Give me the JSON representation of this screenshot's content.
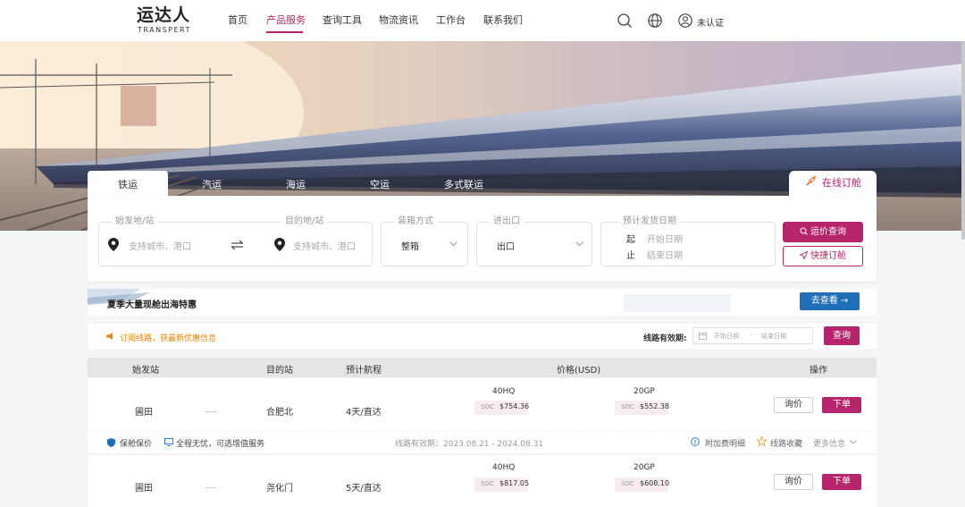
{
  "brand": {
    "logo_main": "运达人",
    "logo_sub": "TRANSPERT",
    "accent": "#b6246b"
  },
  "nav": {
    "items": [
      {
        "label": "首页"
      },
      {
        "label": "产品服务",
        "active": true
      },
      {
        "label": "查询工具"
      },
      {
        "label": "物流资讯"
      },
      {
        "label": "工作台"
      },
      {
        "label": "联系我们"
      }
    ]
  },
  "header": {
    "user_label": "未认证",
    "icons": [
      "search-icon",
      "globe-icon",
      "user-icon"
    ]
  },
  "tabs": [
    {
      "label": "铁运",
      "active": true
    },
    {
      "label": "汽运"
    },
    {
      "label": "海运"
    },
    {
      "label": "空运"
    },
    {
      "label": "多式联运"
    }
  ],
  "online_booking": "在线订舱",
  "search": {
    "origin": {
      "legend": "始发地/站",
      "placeholder": "支持城市、港口"
    },
    "destination": {
      "legend": "目的地/站",
      "placeholder": "支持城市、港口"
    },
    "container": {
      "legend": "装箱方式",
      "value": "整箱"
    },
    "direction": {
      "legend": "进出口",
      "value": "出口"
    },
    "date": {
      "legend": "预计发货日期",
      "start_char": "起",
      "start_placeholder": "开始日期",
      "end_char": "止",
      "end_placeholder": "结束日期"
    },
    "query_button": "运价查询",
    "fast_button": "快捷订舱"
  },
  "promo": {
    "text": "夏季大量现舱出海特惠",
    "button": "去查看 →"
  },
  "subscribe": {
    "text": "订阅线路，获最新优惠信息",
    "validity_label": "线路有效期:",
    "start_placeholder": "开始日期",
    "sep": "-",
    "end_placeholder": "结束日期",
    "button": "查询"
  },
  "table": {
    "headers": [
      "始发站",
      "目的站",
      "预计航程",
      "价格(USD)",
      "操作"
    ],
    "rows": [
      {
        "origin": "圃田",
        "dest": "合肥北",
        "duration": "4天/直达",
        "price_40hq_label": "40HQ",
        "price_40hq": "$754.36",
        "price_20gp_label": "20GP",
        "price_20gp": "$552.38",
        "soc": "SOC",
        "ask": "询价",
        "order": "下单"
      },
      {
        "origin": "圃田",
        "dest": "尧化门",
        "duration": "5天/直达",
        "price_40hq_label": "40HQ",
        "price_40hq": "$817.05",
        "price_20gp_label": "20GP",
        "price_20gp": "$608.10",
        "soc": "SOC",
        "ask": "询价",
        "order": "下单"
      }
    ],
    "service": {
      "insurance": "保舱保价",
      "worry_free": "全程无忧，可选增值服务",
      "validity": "线路有效期：2023.08.21 - 2024.08.31",
      "fee_detail": "附加费明细",
      "favorite": "线路收藏",
      "more": "更多信息"
    }
  }
}
